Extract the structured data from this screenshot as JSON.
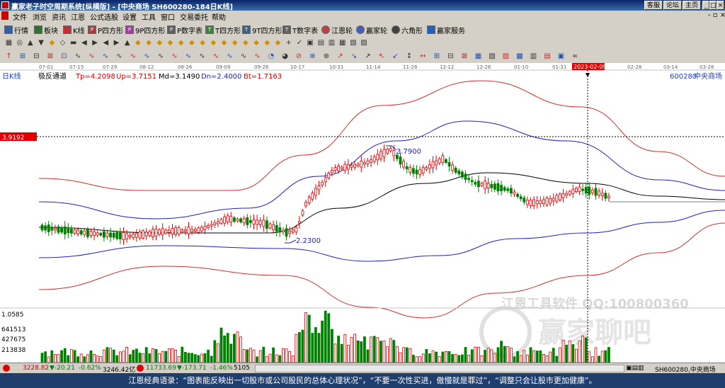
{
  "window": {
    "title": "赢家老子时空周期系统[纵横版] - [中央商场  SH600280-184日K线]",
    "buttons": [
      "客服",
      "论坛",
      "主页"
    ]
  },
  "menu": [
    "文件",
    "浏览",
    "资讯",
    "江恩",
    "公式选股",
    "设置",
    "工具",
    "窗口",
    "交易委托",
    "帮助"
  ],
  "toolbar1": [
    {
      "label": "行情",
      "icon": "quote-icon"
    },
    {
      "label": "板块",
      "icon": "sector-icon"
    },
    {
      "label": "K线",
      "icon": "kline-icon"
    },
    {
      "label": "P四方形",
      "icon": "p-square-icon"
    },
    {
      "label": "9P四方形",
      "icon": "9p-square-icon"
    },
    {
      "label": "P数字表",
      "icon": "p-table-icon"
    },
    {
      "label": "T四方形",
      "icon": "t-square-icon"
    },
    {
      "label": "9T四方形",
      "icon": "9t-square-icon"
    },
    {
      "label": "T数字表",
      "icon": "t-table-icon"
    },
    {
      "label": "江恩轮",
      "icon": "gann-wheel-icon"
    },
    {
      "label": "赢家轮",
      "icon": "winner-wheel-icon"
    },
    {
      "label": "六角形",
      "icon": "hexagon-icon"
    },
    {
      "label": "赢家服务",
      "icon": "service-icon"
    }
  ],
  "chart": {
    "period_label": "日K线",
    "indicator": "极反通道",
    "tp": "Tp=4.2098",
    "up": "Up=3.7151",
    "md": "Md=3.1490",
    "dn": "Dn=2.4000",
    "bt": "Bt=1.7163",
    "stock_code": "600280",
    "stock_name": "中央商场",
    "cursor_price": "3.9192",
    "cursor_date": "2023-02-09",
    "high_label": "3.7900",
    "low_label": "2.2300",
    "date_ticks": [
      "07-01",
      "07-15",
      "07-29",
      "08-12",
      "08-26",
      "09-09",
      "09-26",
      "10-17",
      "10-31",
      "11-14",
      "11-28",
      "12-12",
      "12-26",
      "01-10",
      "01-31",
      "02-28",
      "03-14",
      "03-28"
    ],
    "volume_ticks": [
      "1.0585",
      "641513",
      "427675",
      "213838"
    ],
    "watermark1": "江恩工具软件  QQ:100800360",
    "watermark2": "赢家聊吧"
  },
  "colors": {
    "up": "#e00000",
    "down": "#008000",
    "channel_outer": "#d03030",
    "channel_inner": "#2020c0",
    "mid": "#000000"
  },
  "status": {
    "sh_index": "3228.82",
    "sh_change": "▼-20.21",
    "sh_pct": "-0.62%",
    "sh_amount": "3246.42亿",
    "sz_index": "11733.69",
    "sz_change": "▼-173.71",
    "sz_pct": "-1.46%",
    "sz_amount": "5105",
    "current": "SH600280,中央商场"
  },
  "quote": "江恩经典语录：“图表能反映出一切股市或公司股民的总体心理状况”，“不要一次性买进，傲慢就是罪过”，“调整只会让股市更加健康”。"
}
